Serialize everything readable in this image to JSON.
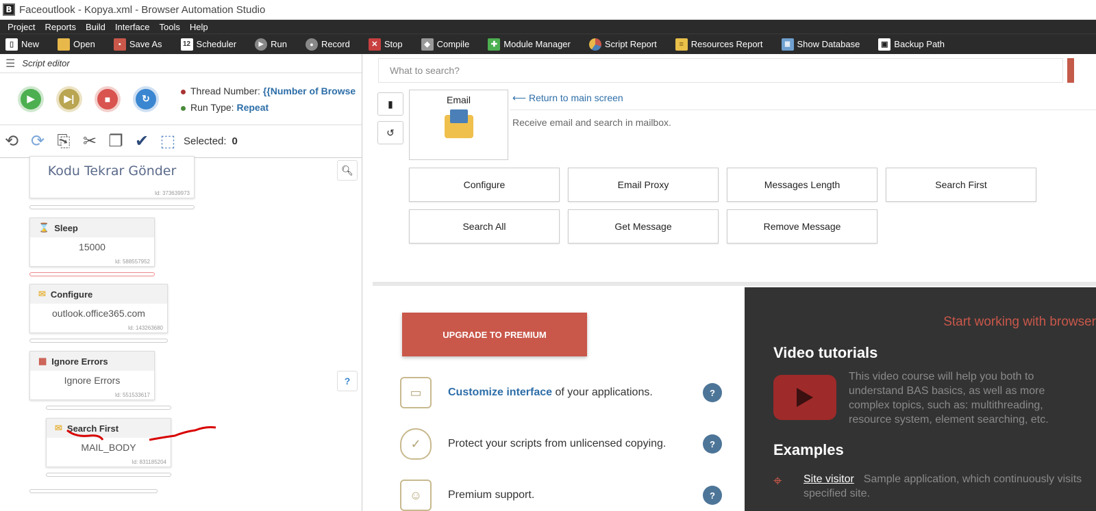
{
  "titlebar": {
    "app_icon": "B",
    "title": "Faceoutlook - Kopya.xml - Browser Automation Studio"
  },
  "menu": [
    "Project",
    "Reports",
    "Build",
    "Interface",
    "Tools",
    "Help"
  ],
  "toolbar": [
    {
      "label": "New",
      "icon": "new-file-icon"
    },
    {
      "label": "Open",
      "icon": "open-folder-icon"
    },
    {
      "label": "Save As",
      "icon": "save-icon"
    },
    {
      "label": "Scheduler",
      "icon": "calendar-icon",
      "badge": "12"
    },
    {
      "label": "Run",
      "icon": "run-icon"
    },
    {
      "label": "Record",
      "icon": "record-icon"
    },
    {
      "label": "Stop",
      "icon": "stop-icon"
    },
    {
      "label": "Compile",
      "icon": "compile-icon"
    },
    {
      "label": "Module Manager",
      "icon": "puzzle-icon"
    },
    {
      "label": "Script Report",
      "icon": "pie-chart-icon"
    },
    {
      "label": "Resources Report",
      "icon": "report-icon"
    },
    {
      "label": "Show Database",
      "icon": "database-icon"
    },
    {
      "label": "Backup Path",
      "icon": "backup-icon"
    }
  ],
  "left": {
    "header": "Script editor",
    "thread_label": "Thread Number:",
    "thread_value": "{{Number of Browse",
    "run_type_label": "Run Type:",
    "run_type_value": "Repeat",
    "selected_label": "Selected:",
    "selected_value": "0",
    "nodes": [
      {
        "title": "",
        "body": "Kodu Tekrar Gönder",
        "id": "Id: 373639973"
      },
      {
        "title": "Sleep",
        "body": "15000",
        "id": "Id: 588557952"
      },
      {
        "title": "Configure",
        "body": "outlook.office365.com",
        "id": "Id: 143263680"
      },
      {
        "title": "Ignore Errors",
        "body": "Ignore Errors",
        "id": "Id: 551533617"
      },
      {
        "title": "Search First",
        "body": "MAIL_BODY",
        "id": "Id: 831185204"
      }
    ]
  },
  "right": {
    "search_placeholder": "What to search?",
    "email_card_label": "Email",
    "return_link": "Return to main screen",
    "description": "Receive email and search in mailbox.",
    "actions": [
      "Configure",
      "Email Proxy",
      "Messages Length",
      "Search First",
      "Search All",
      "Get Message",
      "Remove Message"
    ],
    "premium_button": "UPGRADE TO PREMIUM",
    "feature1_link": "Customize interface",
    "feature1_rest": " of your applications.",
    "feature2": "Protect your scripts from unlicensed copying.",
    "feature3": "Premium support.",
    "help_mark": "?",
    "start_working": "Start working with browser",
    "video_title": "Video tutorials",
    "video_text": "This video course will help you both to understand BAS basics, as well as more complex topics, such as: multithreading, resource system, element searching, etc.",
    "examples_title": "Examples",
    "example_link": "Site visitor",
    "example_text": "Sample application, which continuously visits specified site."
  },
  "colors": {
    "accent": "#c9574a",
    "link": "#2d6ea8",
    "dark_panel": "#333333",
    "toolbar": "#2b2b2b"
  }
}
